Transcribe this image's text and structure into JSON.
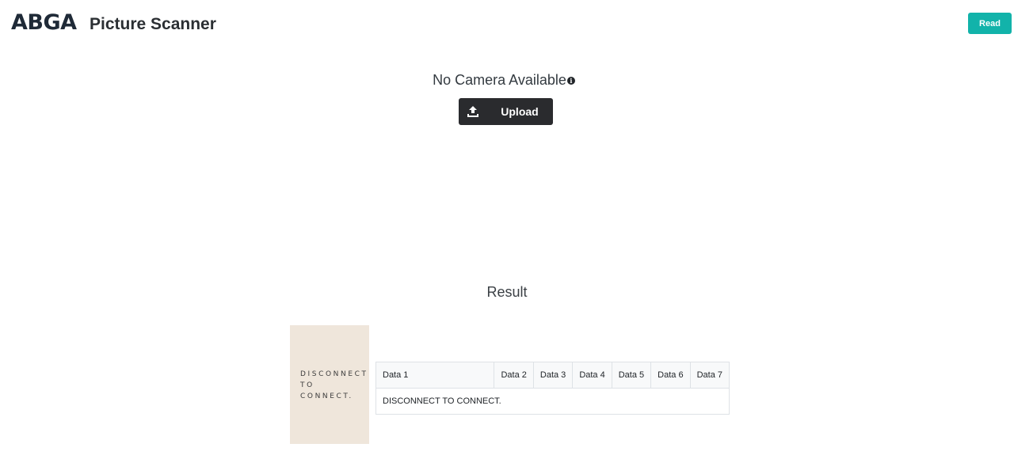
{
  "header": {
    "logo": "ABGA",
    "title": "Picture Scanner",
    "read_label": "Read"
  },
  "camera": {
    "status": "No Camera Available",
    "info_icon": "info-circle-icon",
    "upload_label": "Upload",
    "upload_icon": "upload-icon"
  },
  "result": {
    "heading": "Result",
    "preview_text": "DISCONNECT TO CONNECT.",
    "table": {
      "headers": [
        "Data 1",
        "Data 2",
        "Data 3",
        "Data 4",
        "Data 5",
        "Data 6",
        "Data 7"
      ],
      "rows": [
        [
          "DISCONNECT TO CONNECT."
        ]
      ]
    }
  },
  "colors": {
    "accent": "#12b3aa",
    "dark_button": "#2a2b2e",
    "logo": "#1f2a37",
    "preview_bg": "#efe6db"
  }
}
